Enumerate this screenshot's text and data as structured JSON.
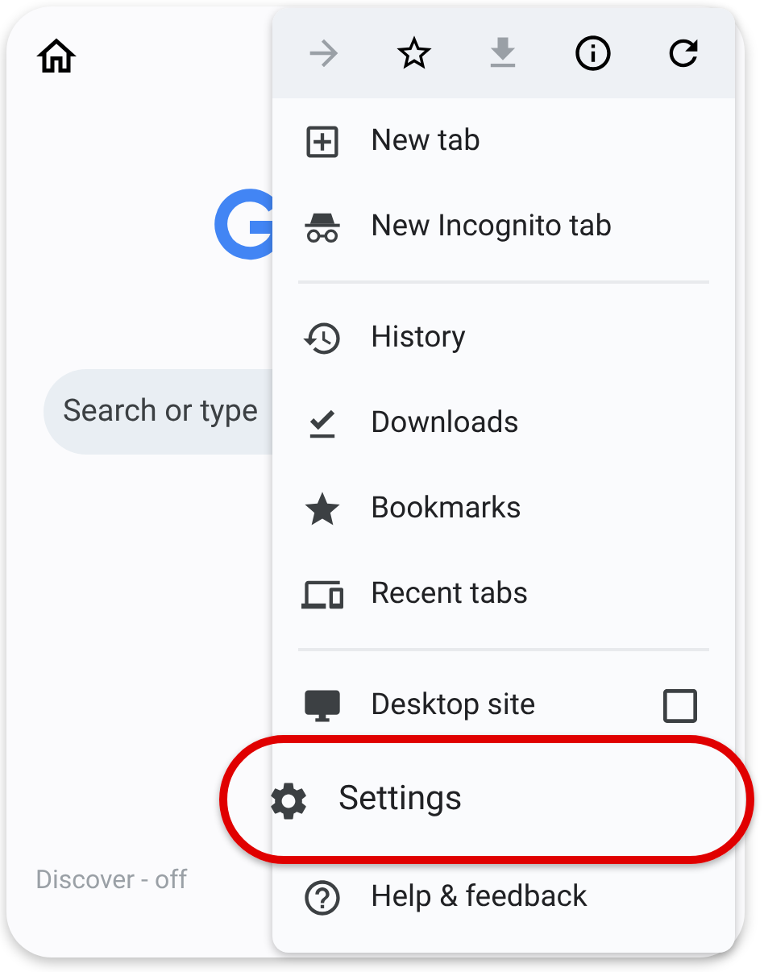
{
  "page": {
    "search": {
      "placeholder": "Search or type"
    },
    "discover": "Discover - off"
  },
  "toolbar": [
    {
      "disabled": true
    },
    {
      "disabled": false
    },
    {
      "disabled": true
    },
    {
      "disabled": false
    },
    {
      "disabled": false
    }
  ],
  "menu": [
    {
      "kind": "item",
      "label": "New tab"
    },
    {
      "kind": "item",
      "label": "New Incognito tab"
    },
    {
      "kind": "divider"
    },
    {
      "kind": "item",
      "label": "History"
    },
    {
      "kind": "item",
      "label": "Downloads"
    },
    {
      "kind": "item",
      "label": "Bookmarks"
    },
    {
      "kind": "item",
      "label": "Recent tabs"
    },
    {
      "kind": "divider"
    },
    {
      "kind": "checkbox",
      "label": "Desktop site",
      "checked": false
    },
    {
      "kind": "item",
      "label": "Settings",
      "highlighted": true
    },
    {
      "kind": "item",
      "label": "Help & feedback"
    }
  ]
}
